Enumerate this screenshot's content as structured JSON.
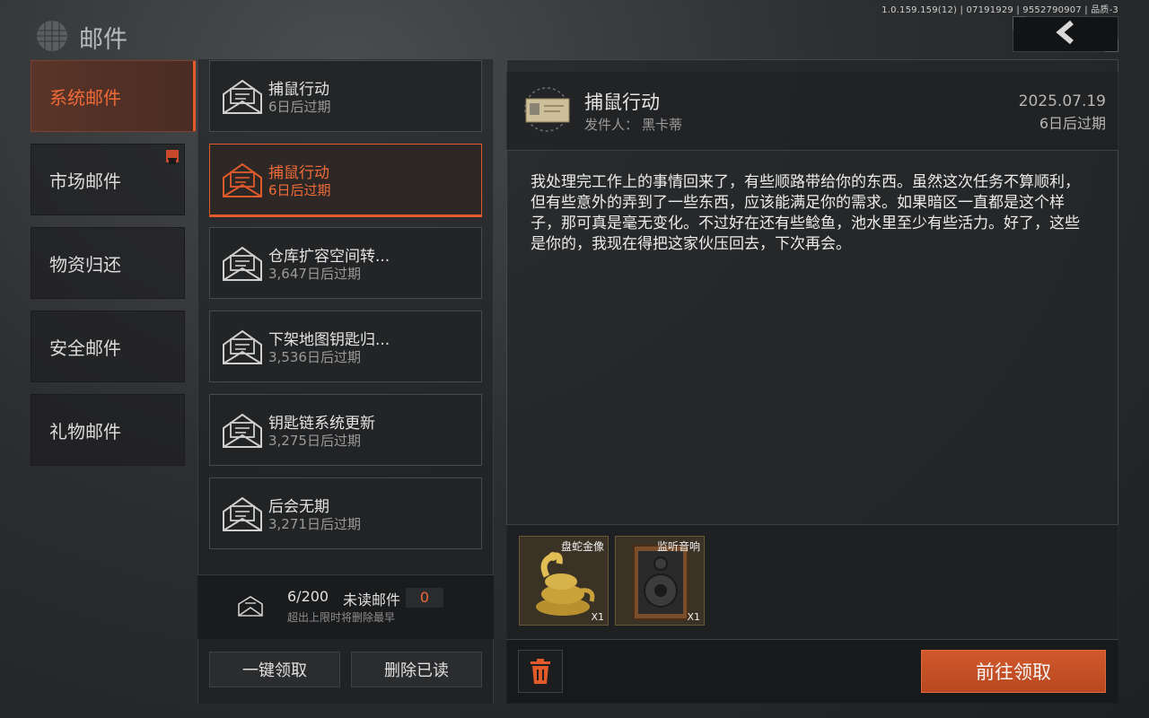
{
  "header": {
    "title": "邮件",
    "version": "1.0.159.159(12) | 07191929 | 9552790907 | 品质-3",
    "back_icon": "chevron-left-icon"
  },
  "categories": [
    {
      "label": "系统邮件",
      "active": true
    },
    {
      "label": "市场邮件",
      "badge": true
    },
    {
      "label": "物资归还"
    },
    {
      "label": "安全邮件"
    },
    {
      "label": "礼物邮件"
    }
  ],
  "mails": [
    {
      "title": "捕鼠行动",
      "expire": "6日后过期"
    },
    {
      "title": "捕鼠行动",
      "expire": "6日后过期",
      "selected": true
    },
    {
      "title": "仓库扩容空间转...",
      "expire": "3,647日后过期"
    },
    {
      "title": "下架地图钥匙归...",
      "expire": "3,536日后过期"
    },
    {
      "title": "钥匙链系统更新",
      "expire": "3,275日后过期"
    },
    {
      "title": "后会无期",
      "expire": "3,271日后过期"
    }
  ],
  "counts": {
    "mail_count": "6/200",
    "unread_label": "未读邮件",
    "unread_count": "0",
    "note": "超出上限时将删除最早"
  },
  "actions": {
    "claim_all": "一键领取",
    "delete_read": "删除已读",
    "go_claim": "前往领取"
  },
  "detail": {
    "title": "捕鼠行动",
    "sender_label": "发件人：",
    "sender": "黑卡蒂",
    "date": "2025.07.19",
    "expire": "6日后过期",
    "body": "我处理完工作上的事情回来了，有些顺路带给你的东西。虽然这次任务不算顺利，但有些意外的弄到了一些东西，应该能满足你的需求。如果暗区一直都是这个样子，那可真是毫无变化。不过好在还有些鲶鱼，池水里至少有些活力。好了，这些是你的，我现在得把这家伙压回去，下次再会。"
  },
  "attachments": [
    {
      "name": "盘蛇金像",
      "qty": "X1"
    },
    {
      "name": "监听音响",
      "qty": "X1"
    }
  ],
  "colors": {
    "accent": "#e05a2a",
    "claim_button": "#c4502a"
  }
}
